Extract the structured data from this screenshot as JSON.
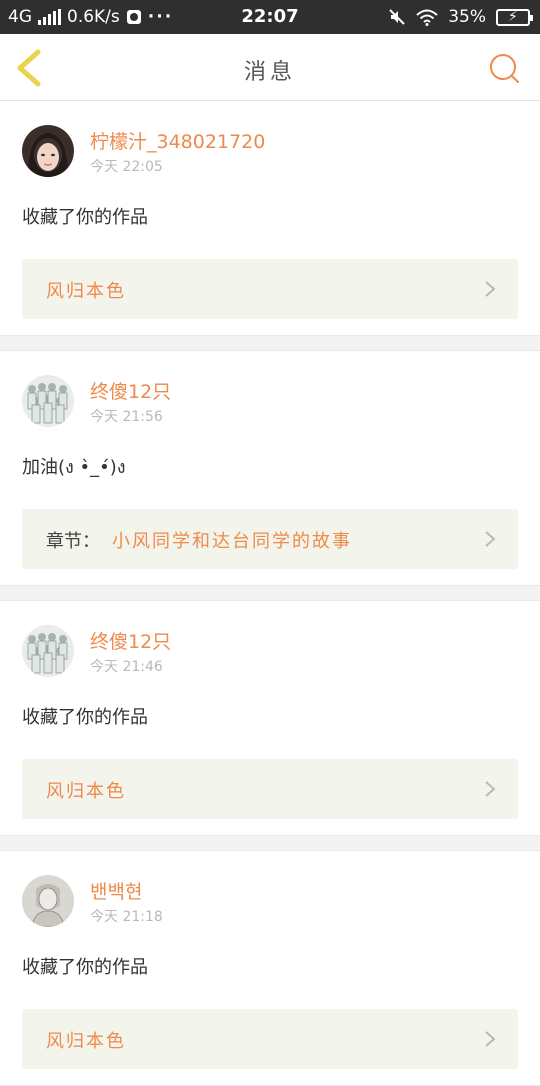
{
  "status_bar": {
    "network": "4G",
    "speed": "0.6K/s",
    "dots": "···",
    "time": "22:07",
    "battery": "35%"
  },
  "nav": {
    "title": "消息",
    "accent": "#ee8a4c"
  },
  "messages": [
    {
      "username": "柠檬汁_348021720",
      "time": "今天 22:05",
      "text": "收藏了你的作品",
      "link_prefix": "",
      "link": "风归本色"
    },
    {
      "username": "终傻12只",
      "time": "今天 21:56",
      "text": "加油(ง •̀_•́)ง",
      "link_prefix": "章节：",
      "link": "小风同学和达台同学的故事"
    },
    {
      "username": "终傻12只",
      "time": "今天 21:46",
      "text": "收藏了你的作品",
      "link_prefix": "",
      "link": "风归本色"
    },
    {
      "username": "밴백현",
      "time": "今天 21:18",
      "text": "收藏了你的作品",
      "link_prefix": "",
      "link": "风归本色"
    }
  ]
}
